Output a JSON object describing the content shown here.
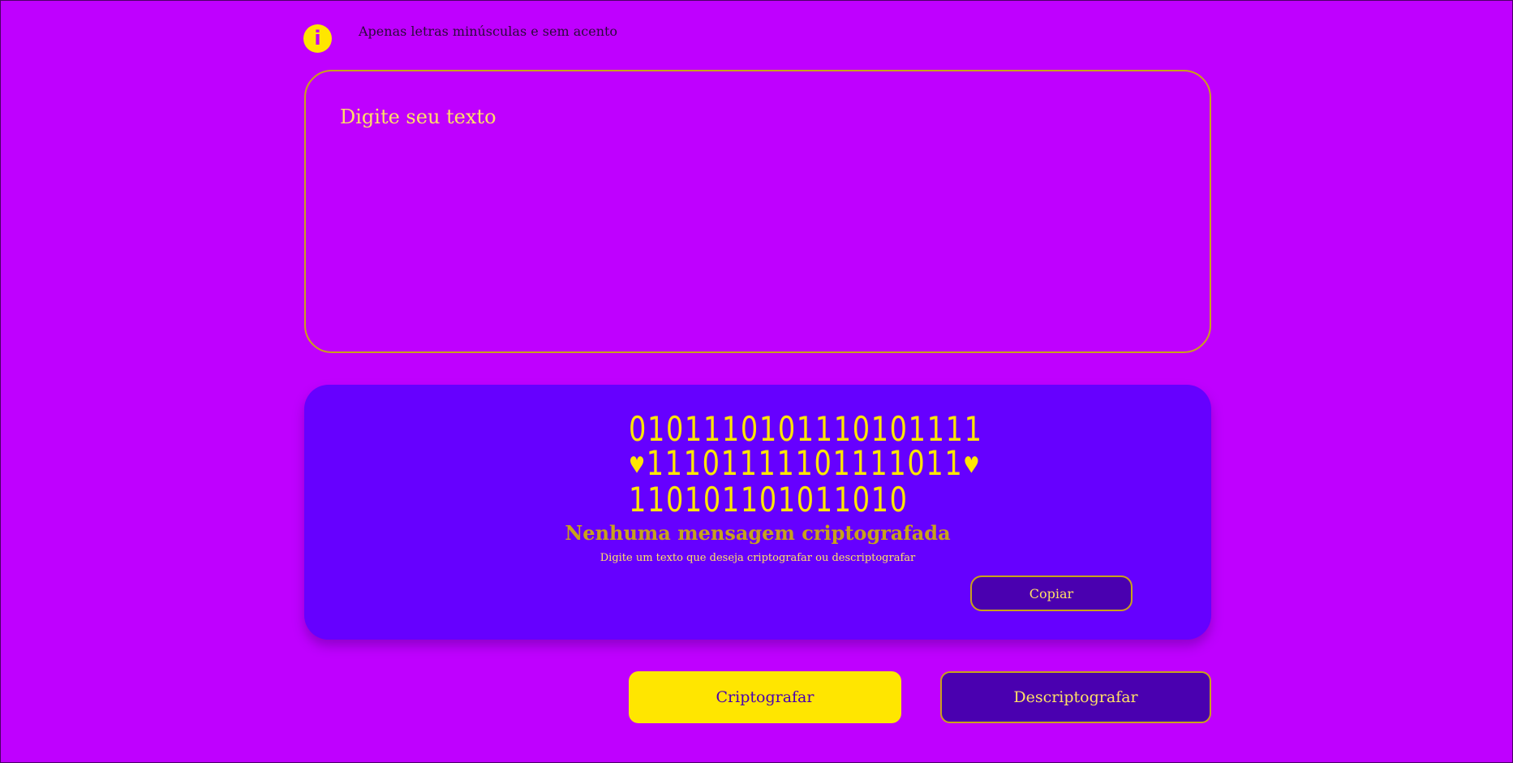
{
  "colors": {
    "background": "#bf00ff",
    "accent_yellow": "#ffe600",
    "panel": "#6600ff",
    "dark_button": "#4a00b0",
    "border_gold": "#c9a21a"
  },
  "info": {
    "icon": "info-icon",
    "icon_glyph": "i",
    "text": "Apenas letras minúsculas e sem acento"
  },
  "input": {
    "placeholder": "Digite seu texto",
    "value": ""
  },
  "output": {
    "art_lines": [
      "0101110101110101111",
      "11101111101111011",
      "110101101011010"
    ],
    "heart_glyph": "♥",
    "title": "Nenhuma mensagem criptografada",
    "subtitle": "Digite um texto que deseja criptografar ou descriptografar",
    "copy_label": "Copiar"
  },
  "actions": {
    "encrypt_label": "Criptografar",
    "decrypt_label": "Descriptografar"
  }
}
